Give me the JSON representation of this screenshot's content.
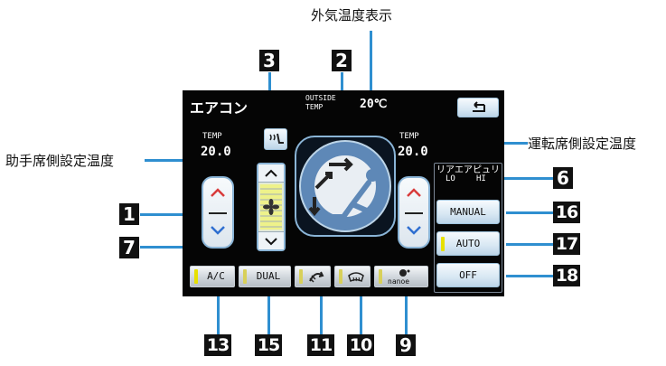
{
  "annotations": {
    "outside_temp_display": "外気温度表示",
    "passenger_set_temp": "助手席側設定温度",
    "driver_set_temp": "運転席側設定温度"
  },
  "callouts": [
    "1",
    "2",
    "3",
    "6",
    "7",
    "9",
    "10",
    "11",
    "13",
    "15",
    "16",
    "17",
    "18"
  ],
  "screen": {
    "title": "エアコン",
    "outside_label_line1": "OUTSIDE",
    "outside_label_line2": "TEMP",
    "outside_value": "20℃",
    "left_temp_label": "TEMP",
    "left_temp_value": "20.0",
    "right_temp_label": "TEMP",
    "right_temp_value": "20.0",
    "rear_purifier_title": "リアエアピュリ",
    "rear_lo": "LO",
    "rear_hi": "HI",
    "rear_manual": "MANUAL",
    "rear_auto": "AUTO",
    "rear_off": "OFF",
    "bottom_ac": "A/C",
    "bottom_dual": "DUAL",
    "bottom_nanoe": "nanoe"
  },
  "icons": [
    "back-arrow-icon",
    "seat-defog-icon",
    "fan-icon",
    "recirculate-icon",
    "windshield-defog-icon",
    "nanoe-icon",
    "seat-icon",
    "chevron-up-icon",
    "chevron-down-icon"
  ],
  "colors": {
    "callout_bg": "#111111",
    "leader_line": "#2f8fd0",
    "screen_bg": "#050505",
    "indicator_on": "#e7e000"
  }
}
